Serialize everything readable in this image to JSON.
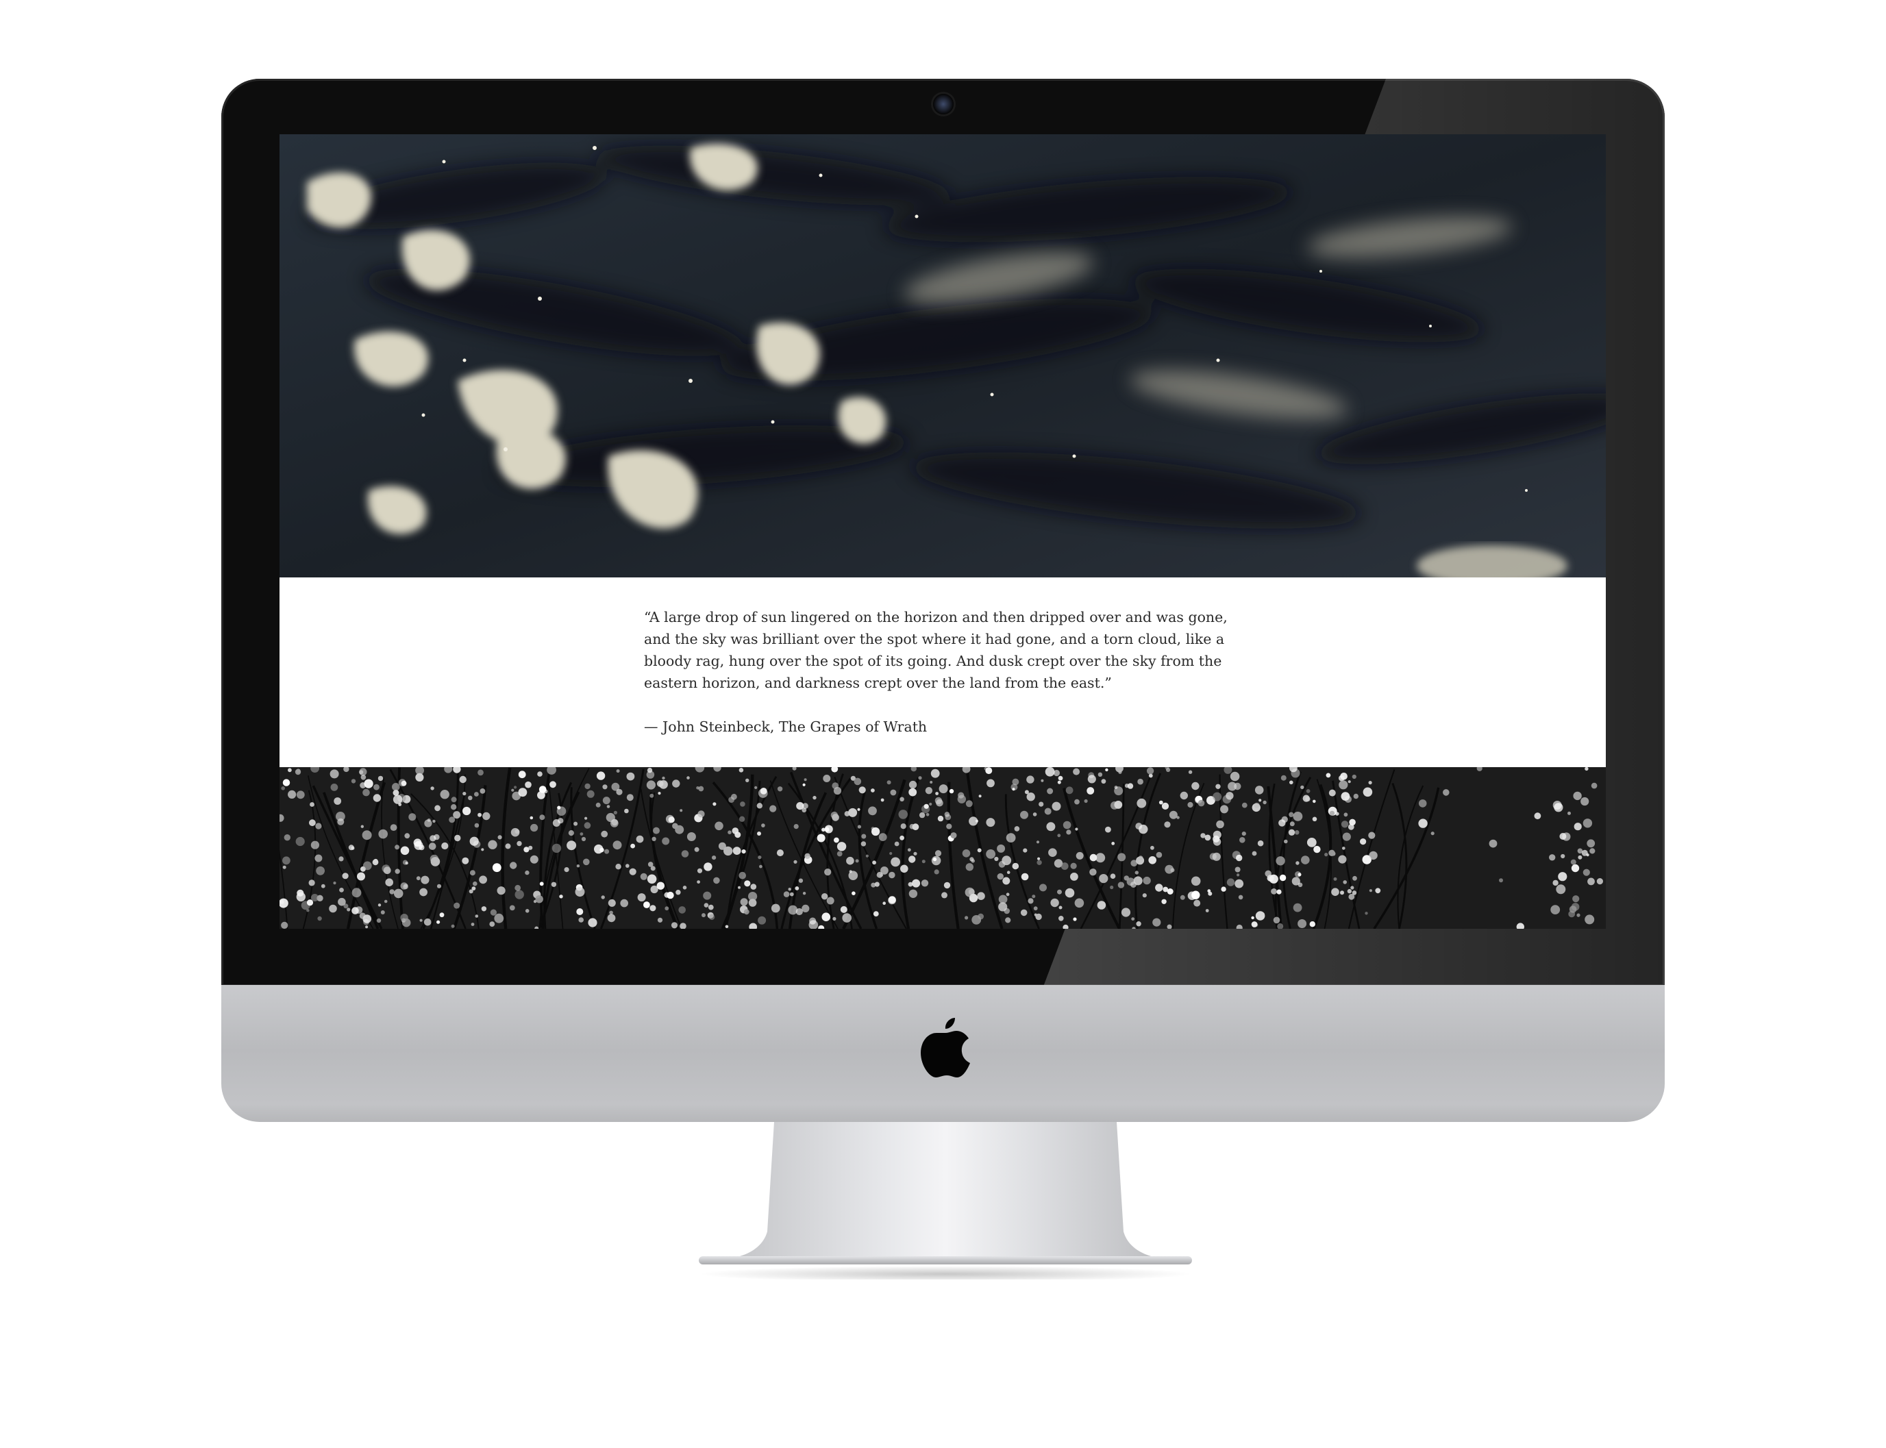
{
  "page": {
    "quote": {
      "text": "“A large drop of sun lingered on the horizon and then dripped over and was gone, and the sky was brilliant over the spot where it had gone, and a torn cloud, like a bloody rag, hung over the spot of its going. And dusk crept over the sky from the eastern horizon, and darkness crept over the land from the east.”",
      "attribution": "— John Steinbeck, The Grapes of Wrath"
    },
    "images": {
      "hero": "water-ripples-photo",
      "footer": "blossom-branches-photo"
    }
  },
  "device": {
    "logo": "apple-logo-icon",
    "camera": "camera-icon"
  },
  "colors": {
    "bezel": "#0d0d0d",
    "aluminum": "#c4c5c8",
    "quote_background": "#ffffff",
    "quote_text": "#2b2b2b",
    "water_dark": "#1a1f25",
    "water_highlight": "#d8d4c0",
    "blossom_dark": "#1c1c1c"
  }
}
